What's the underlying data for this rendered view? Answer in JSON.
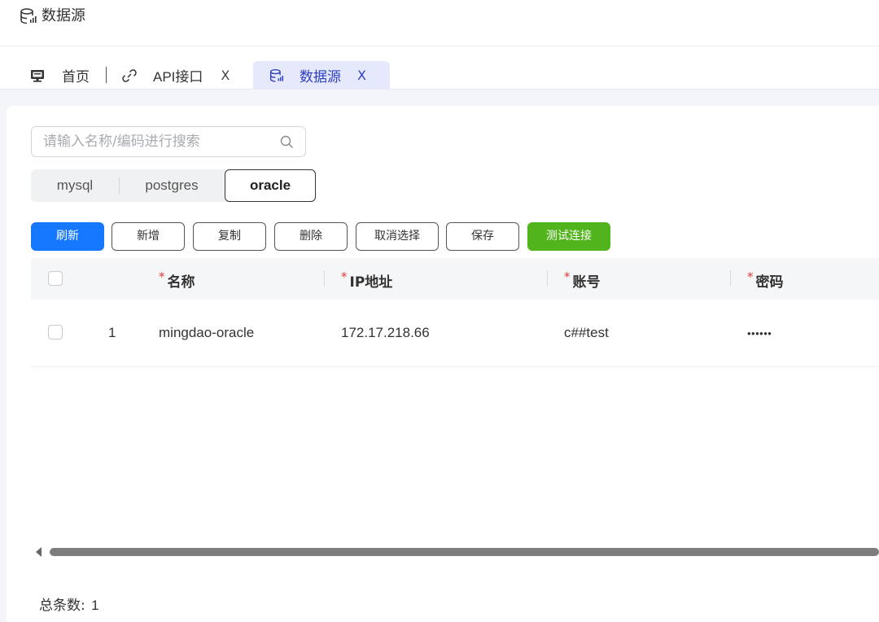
{
  "header": {
    "title": "数据源",
    "icon": "database-icon"
  },
  "tabs": [
    {
      "label": "首页",
      "icon": "monitor-icon",
      "closable": false
    },
    {
      "label": "API接口",
      "icon": "link-icon",
      "closable": true
    },
    {
      "label": "数据源",
      "icon": "database-icon",
      "closable": true,
      "active": true
    }
  ],
  "tab_close_glyph": "X",
  "search": {
    "placeholder": "请输入名称/编码进行搜索",
    "value": ""
  },
  "db_types": {
    "items": [
      "mysql",
      "postgres",
      "oracle"
    ],
    "selected": "oracle"
  },
  "toolbar": {
    "refresh": "刷新",
    "add": "新增",
    "copy": "复制",
    "delete": "删除",
    "deselect": "取消选择",
    "save": "保存",
    "test": "测试连接"
  },
  "table": {
    "required_mark": "*",
    "columns": [
      "名称",
      "IP地址",
      "账号",
      "密码"
    ],
    "rows": [
      {
        "index": "1",
        "name": "mingdao-oracle",
        "ip": "172.17.218.66",
        "account": "c##test",
        "password": "••••••"
      }
    ]
  },
  "footer": {
    "total_label": "总条数:",
    "total_value": "1"
  },
  "colors": {
    "primary": "#1677ff",
    "success": "#52b41c",
    "active_tab_bg": "#e6e9fb",
    "active_tab_text": "#2f3fbf",
    "required": "#e23a3a"
  }
}
